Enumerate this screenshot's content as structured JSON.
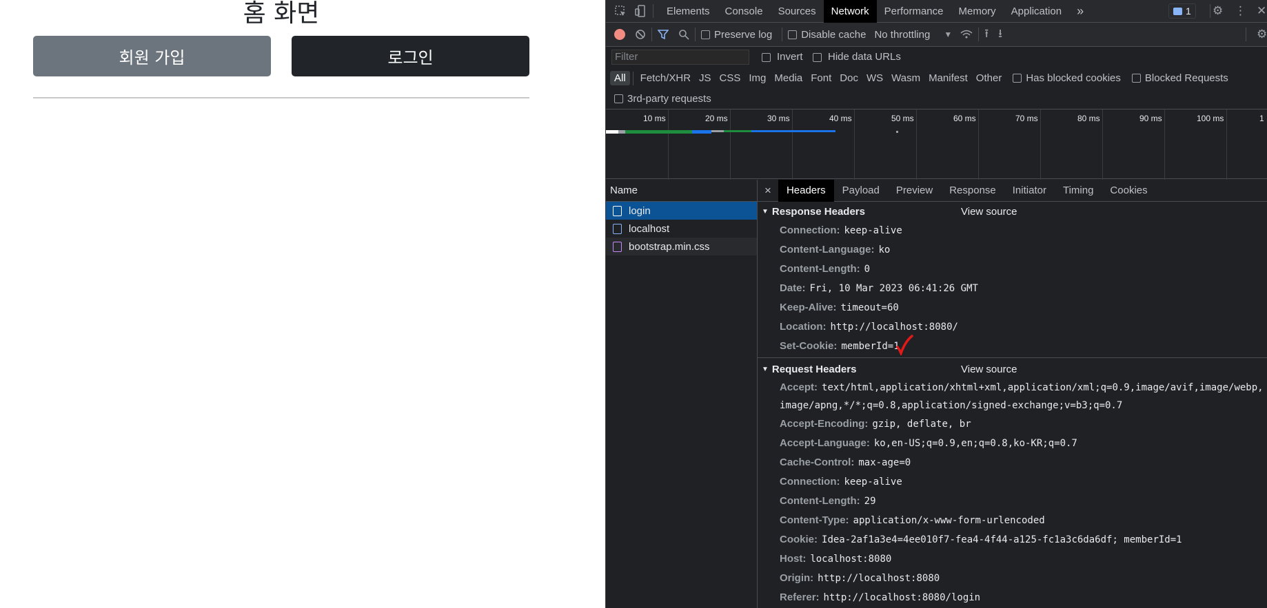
{
  "web": {
    "title": "홈 화면",
    "signup_label": "회원 가입",
    "login_label": "로그인"
  },
  "devtools": {
    "tabs": [
      "Elements",
      "Console",
      "Sources",
      "Network",
      "Performance",
      "Memory",
      "Application"
    ],
    "more": "»",
    "issues_count": "1",
    "toolbar": {
      "preserve_log": "Preserve log",
      "disable_cache": "Disable cache",
      "throttling": "No throttling"
    },
    "filter": {
      "placeholder": "Filter",
      "invert": "Invert",
      "hide_data_urls": "Hide data URLs"
    },
    "types": [
      "All",
      "Fetch/XHR",
      "JS",
      "CSS",
      "Img",
      "Media",
      "Font",
      "Doc",
      "WS",
      "Wasm",
      "Manifest",
      "Other"
    ],
    "blocked_cookies": "Has blocked cookies",
    "blocked_requests": "Blocked Requests",
    "third_party": "3rd-party requests",
    "timeline_ticks": [
      "10 ms",
      "20 ms",
      "30 ms",
      "40 ms",
      "50 ms",
      "60 ms",
      "70 ms",
      "80 ms",
      "90 ms",
      "100 ms",
      "1"
    ],
    "name_header": "Name",
    "requests": [
      "login",
      "localhost",
      "bootstrap.min.css"
    ],
    "detail_tabs": [
      "Headers",
      "Payload",
      "Preview",
      "Response",
      "Initiator",
      "Timing",
      "Cookies"
    ],
    "close": "×",
    "response_headers_title": "Response Headers",
    "request_headers_title": "Request Headers",
    "view_source": "View source",
    "response_headers": [
      {
        "k": "Connection:",
        "v": "keep-alive"
      },
      {
        "k": "Content-Language:",
        "v": "ko"
      },
      {
        "k": "Content-Length:",
        "v": "0"
      },
      {
        "k": "Date:",
        "v": "Fri, 10 Mar 2023 06:41:26 GMT"
      },
      {
        "k": "Keep-Alive:",
        "v": "timeout=60"
      },
      {
        "k": "Location:",
        "v": "http://localhost:8080/"
      },
      {
        "k": "Set-Cookie:",
        "v": "memberId=1"
      }
    ],
    "request_headers": [
      {
        "k": "Accept:",
        "v": "text/html,application/xhtml+xml,application/xml;q=0.9,image/avif,image/webp,image/apng,*/*;q=0.8,application/signed-exchange;v=b3;q=0.7"
      },
      {
        "k": "Accept-Encoding:",
        "v": "gzip, deflate, br"
      },
      {
        "k": "Accept-Language:",
        "v": "ko,en-US;q=0.9,en;q=0.8,ko-KR;q=0.7"
      },
      {
        "k": "Cache-Control:",
        "v": "max-age=0"
      },
      {
        "k": "Connection:",
        "v": "keep-alive"
      },
      {
        "k": "Content-Length:",
        "v": "29"
      },
      {
        "k": "Content-Type:",
        "v": "application/x-www-form-urlencoded"
      },
      {
        "k": "Cookie:",
        "v": "Idea-2af1a3e4=4ee010f7-fea4-4f44-a125-fc1a3c6da6df; memberId=1"
      },
      {
        "k": "Host:",
        "v": "localhost:8080"
      },
      {
        "k": "Origin:",
        "v": "http://localhost:8080"
      },
      {
        "k": "Referer:",
        "v": "http://localhost:8080/login"
      }
    ]
  }
}
